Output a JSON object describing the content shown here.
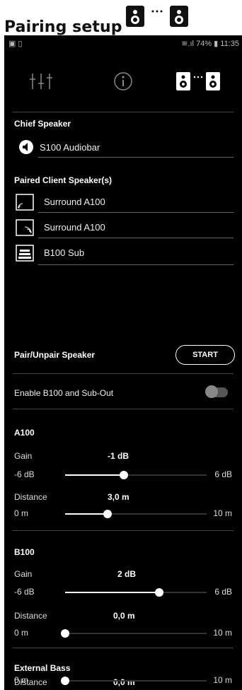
{
  "page": {
    "title": "Pairing setup"
  },
  "status": {
    "battery": "74%",
    "time": "11:35"
  },
  "chief": {
    "label": "Chief Speaker",
    "speaker": "S100 Audiobar"
  },
  "paired": {
    "label": "Paired Client Speaker(s)",
    "items": [
      {
        "name": "Surround A100",
        "icon": "surround-left-icon"
      },
      {
        "name": "Surround A100",
        "icon": "surround-right-icon"
      },
      {
        "name": "B100 Sub",
        "icon": "subwoofer-icon"
      }
    ]
  },
  "pair_unpair": {
    "label": "Pair/Unpair Speaker",
    "button": "START"
  },
  "enable_b100": {
    "label": "Enable B100 and Sub-Out",
    "on": false
  },
  "a100": {
    "title": "A100",
    "gain": {
      "label": "Gain",
      "value": "-1 dB",
      "min": "-6 dB",
      "max": "6 dB",
      "fraction": 0.4167
    },
    "distance": {
      "label": "Distance",
      "value": "3,0 m",
      "min": "0 m",
      "max": "10 m",
      "fraction": 0.3
    }
  },
  "b100": {
    "title": "B100",
    "gain": {
      "label": "Gain",
      "value": "2 dB",
      "min": "-6 dB",
      "max": "6 dB",
      "fraction": 0.6667
    },
    "distance": {
      "label": "Distance",
      "value": "0,0 m",
      "min": "0 m",
      "max": "10 m",
      "fraction": 0.0
    }
  },
  "external_bass": {
    "title": "External Bass",
    "distance": {
      "label": "Distance",
      "value": "0,0 m",
      "min": "0 m",
      "max": "10 m",
      "fraction": 0.0
    }
  }
}
